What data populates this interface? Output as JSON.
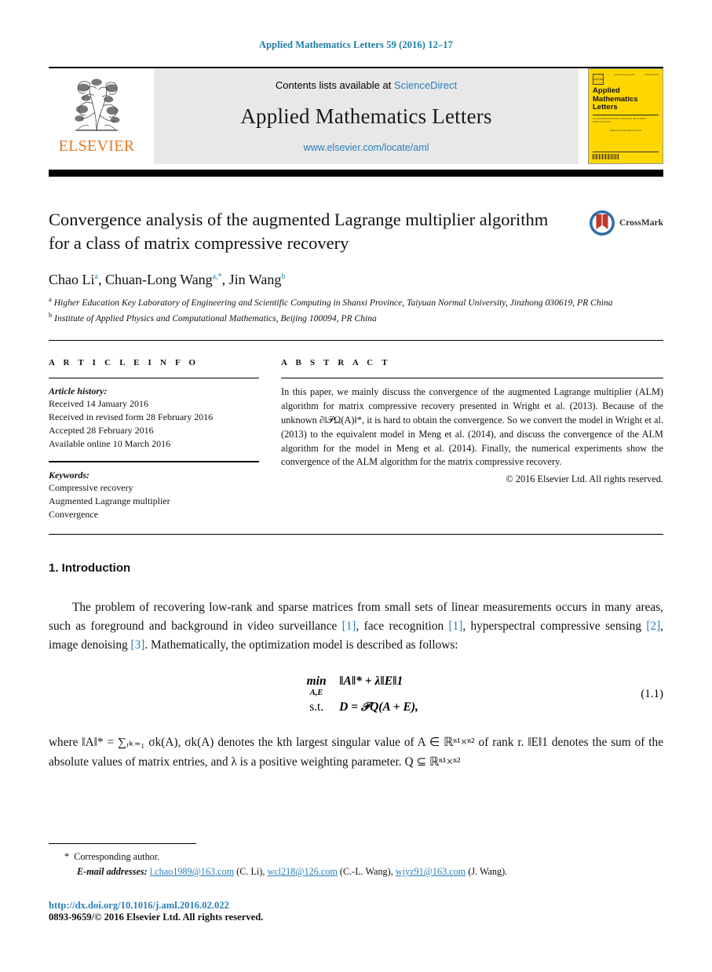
{
  "running_head": "Applied Mathematics Letters 59 (2016) 12–17",
  "masthead": {
    "contents_prefix": "Contents lists available at ",
    "sciencedirect": "ScienceDirect",
    "journal_title": "Applied Mathematics Letters",
    "journal_url": "www.elsevier.com/locate/aml",
    "publisher": "ELSEVIER",
    "cover": {
      "title_line1": "Applied",
      "title_line2": "Mathematics",
      "title_line3": "Letters",
      "top_left": "Volume 59  January 2016",
      "top_right": "ISSN 0893-9659",
      "subtitle": "AN INTERNATIONAL JOURNAL OF RAPID PUBLICATION",
      "editor": "Editor-in-Chief: Ryan Loxton",
      "elsevier_mark": "ELSEVIER"
    }
  },
  "article": {
    "title": "Convergence analysis of the augmented Lagrange multiplier algorithm for a class of matrix compressive recovery",
    "crossmark_label": "CrossMark",
    "authors": [
      {
        "name": "Chao Li",
        "marks": "a"
      },
      {
        "name": "Chuan-Long Wang",
        "marks": "a,*"
      },
      {
        "name": "Jin Wang",
        "marks": "b"
      }
    ],
    "affiliations": [
      {
        "mark": "a",
        "text": "Higher Education Key Laboratory of Engineering and Scientific Computing in Shanxi Province, Taiyuan Normal University, Jinzhong 030619, PR China"
      },
      {
        "mark": "b",
        "text": "Institute of Applied Physics and Computational Mathematics, Beijing 100094, PR China"
      }
    ]
  },
  "info": {
    "heading": "A R T I C L E   I N F O",
    "history_label": "Article history:",
    "history": [
      "Received 14 January 2016",
      "Received in revised form 28 February 2016",
      "Accepted 28 February 2016",
      "Available online 10 March 2016"
    ],
    "keywords_label": "Keywords:",
    "keywords": [
      "Compressive recovery",
      "Augmented Lagrange multiplier",
      "Convergence"
    ]
  },
  "abstract": {
    "heading": "A B S T R A C T",
    "text": "In this paper, we mainly discuss the convergence of the augmented Lagrange multiplier (ALM) algorithm for matrix compressive recovery presented in Wright et al. (2013). Because of the unknown ∂‖𝒫Ω(A)‖*, it is hard to obtain the convergence. So we convert the model in Wright et al. (2013) to the equivalent model in Meng et al. (2014), and discuss the convergence of the ALM algorithm for the model in Meng et al. (2014). Finally, the numerical experiments show the convergence of the ALM algorithm for the matrix compressive recovery.",
    "copyright": "© 2016 Elsevier Ltd. All rights reserved."
  },
  "body": {
    "section_number_title": "1.  Introduction",
    "paragraph1_pre": "The problem of recovering low-rank and sparse matrices from small sets of linear measurements occurs in many areas, such as foreground and background in video surveillance ",
    "ref1": "[1]",
    "paragraph1_mid1": ", face recognition ",
    "ref2": "[1]",
    "paragraph1_mid2": ", hyperspectral compressive sensing ",
    "ref3": "[2]",
    "paragraph1_mid3": ", image denoising ",
    "ref4": "[3]",
    "paragraph1_end": ". Mathematically, the optimization model is described as follows:",
    "equation": {
      "min_op": "min",
      "min_sub": "A,E",
      "objective": "‖A‖* + λ‖E‖1",
      "st_label": "s.t.",
      "constraint": "D = 𝒫Q(A + E),",
      "number": "(1.1)"
    },
    "paragraph2": "where ‖A‖* = ∑ᵣₖ₌₁ σk(A), σk(A) denotes the kth largest singular value of A ∈ ℝⁿ¹×ⁿ² of rank r. ‖E‖1 denotes the sum of the absolute values of matrix entries, and λ is a positive weighting parameter. Q ⊆ ℝⁿ¹×ⁿ²"
  },
  "footnotes": {
    "corresponding_mark": "*",
    "corresponding_text": "Corresponding author.",
    "email_label": "E-mail addresses:",
    "emails": [
      {
        "address": "l.chao1989@163.com",
        "owner": "(C. Li)"
      },
      {
        "address": "wcl218@126.com",
        "owner": "(C.-L. Wang)"
      },
      {
        "address": "wjyz91@163.com",
        "owner": "(J. Wang)"
      }
    ],
    "doi": "http://dx.doi.org/10.1016/j.aml.2016.02.022",
    "issn_line": "0893-9659/© 2016 Elsevier Ltd. All rights reserved."
  },
  "colors": {
    "link_blue": "#2a7fb8",
    "elsevier_orange": "#e87722",
    "cover_yellow": "#ffd700",
    "crossmark_blue": "#2b6ea8",
    "crossmark_red": "#c0392b"
  }
}
